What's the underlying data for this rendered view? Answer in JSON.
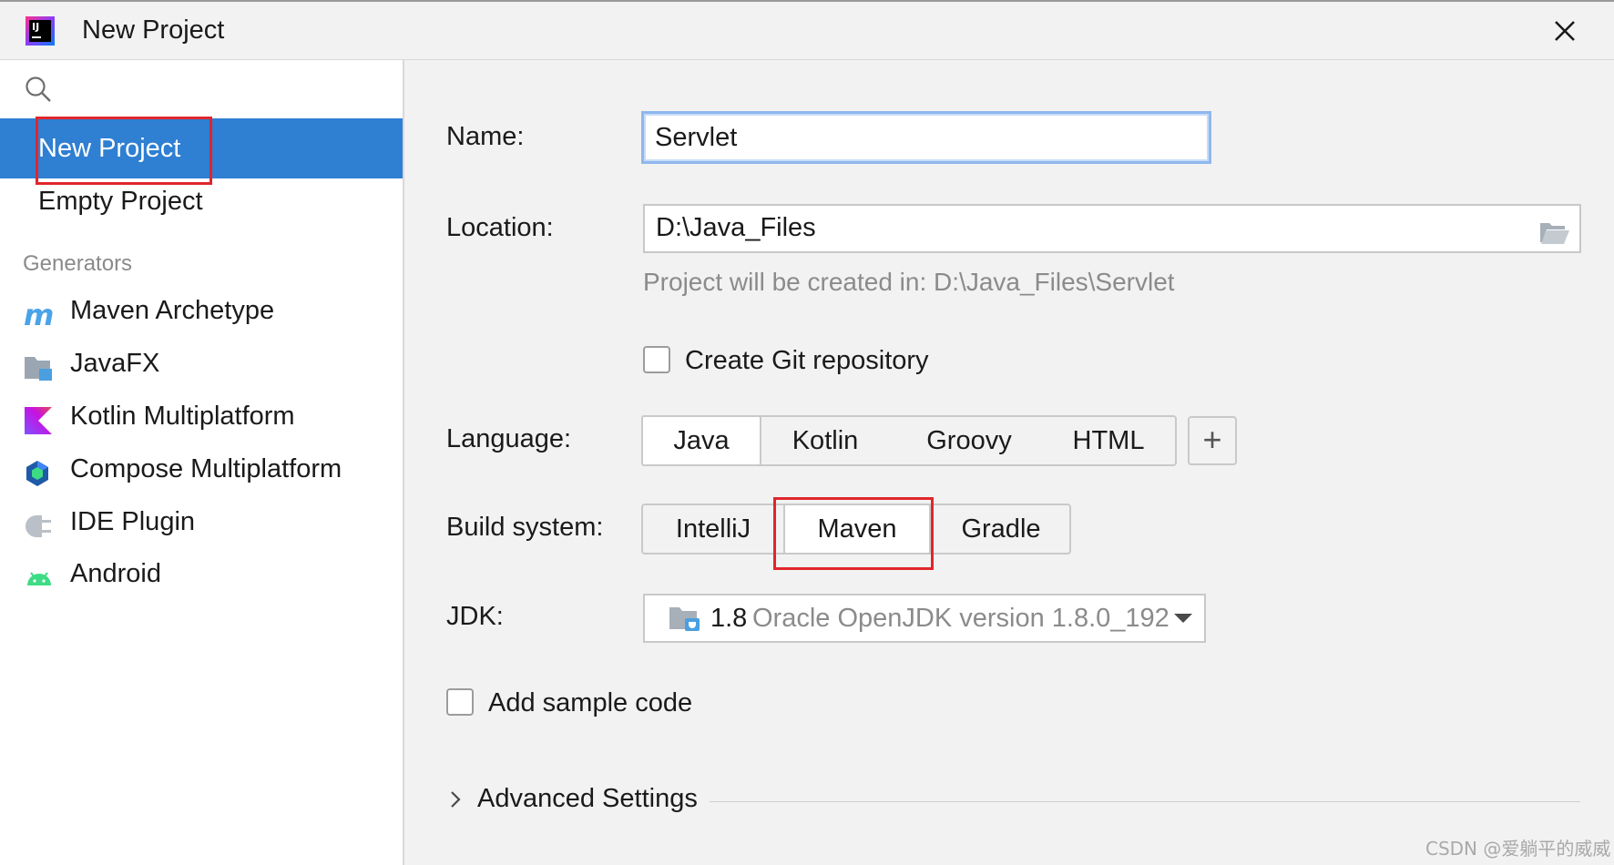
{
  "window": {
    "title": "New Project",
    "close_icon": "close-icon"
  },
  "sidebar": {
    "search_icon": "search-icon",
    "items": [
      {
        "label": "New Project",
        "selected": true
      },
      {
        "label": "Empty Project",
        "selected": false
      }
    ],
    "generators_header": "Generators",
    "generators": [
      {
        "label": "Maven Archetype",
        "icon": "maven-icon"
      },
      {
        "label": "JavaFX",
        "icon": "javafx-icon"
      },
      {
        "label": "Kotlin Multiplatform",
        "icon": "kotlin-icon"
      },
      {
        "label": "Compose Multiplatform",
        "icon": "compose-icon"
      },
      {
        "label": "IDE Plugin",
        "icon": "plugin-icon"
      },
      {
        "label": "Android",
        "icon": "android-icon"
      }
    ]
  },
  "form": {
    "name_label": "Name:",
    "name_value": "Servlet",
    "location_label": "Location:",
    "location_value": "D:\\Java_Files",
    "location_hint": "Project will be created in: D:\\Java_Files\\Servlet",
    "git_label": "Create Git repository",
    "git_checked": false,
    "language_label": "Language:",
    "languages": [
      "Java",
      "Kotlin",
      "Groovy",
      "HTML"
    ],
    "language_selected": "Java",
    "add_language": "+",
    "build_label": "Build system:",
    "build_systems": [
      "IntelliJ",
      "Maven",
      "Gradle"
    ],
    "build_selected": "Maven",
    "jdk_label": "JDK:",
    "jdk_version": "1.8",
    "jdk_name": "Oracle OpenJDK version 1.8.0_192",
    "sample_label": "Add sample code",
    "sample_checked": false,
    "advanced_label": "Advanced Settings"
  },
  "colors": {
    "selection": "#2f7fd2",
    "highlight_box": "#e0262b",
    "focus_ring": "#8fb8ee"
  },
  "watermark": "CSDN @爱躺平的威威"
}
